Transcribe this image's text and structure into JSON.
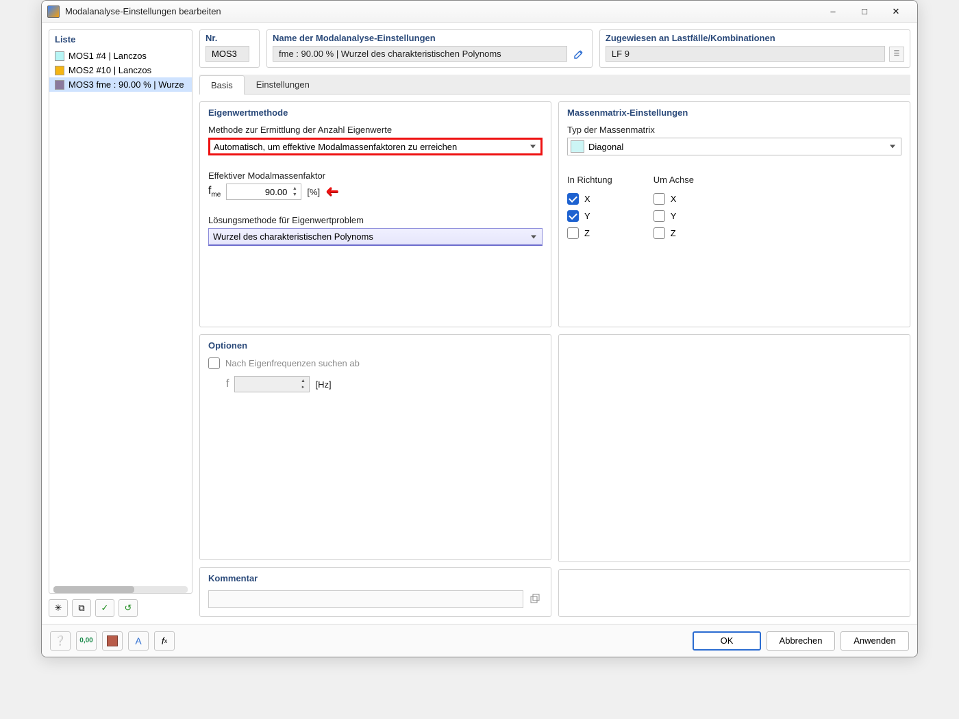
{
  "window": {
    "title": "Modalanalyse-Einstellungen bearbeiten"
  },
  "listPanel": {
    "title": "Liste",
    "items": [
      {
        "swatch": "#b7f5f5",
        "label": "MOS1 #4 | Lanczos"
      },
      {
        "swatch": "#f5b514",
        "label": "MOS2 #10 | Lanczos"
      },
      {
        "swatch": "#8b7a9c",
        "label": "MOS3 fme : 90.00 % | Wurze",
        "selected": true
      }
    ]
  },
  "header": {
    "nrLabel": "Nr.",
    "nrValue": "MOS3",
    "nameLabel": "Name der Modalanalyse-Einstellungen",
    "nameValue": "fme : 90.00 % | Wurzel des charakteristischen Polynoms",
    "assignLabel": "Zugewiesen an Lastfälle/Kombinationen",
    "assignValue": "LF 9"
  },
  "tabs": {
    "t1": "Basis",
    "t2": "Einstellungen"
  },
  "eigen": {
    "groupTitle": "Eigenwertmethode",
    "methodLabel": "Methode zur Ermittlung der Anzahl Eigenwerte",
    "methodValue": "Automatisch, um effektive Modalmassenfaktoren zu erreichen",
    "factorLabel": "Effektiver Modalmassenfaktor",
    "factorSymbol": "fme",
    "factorValue": "90.00",
    "factorUnit": "[%]",
    "solLabel": "Lösungsmethode für Eigenwertproblem",
    "solValue": "Wurzel des charakteristischen Polynoms"
  },
  "mass": {
    "groupTitle": "Massenmatrix-Einstellungen",
    "typeLabel": "Typ der Massenmatrix",
    "typeValue": "Diagonal",
    "dirLabel": "In Richtung",
    "axisLabel": "Um Achse",
    "axes": {
      "x": "X",
      "y": "Y",
      "z": "Z"
    }
  },
  "options": {
    "groupTitle": "Optionen",
    "eigenfreq": "Nach Eigenfrequenzen suchen ab",
    "fSymbol": "f",
    "fUnit": "[Hz]"
  },
  "comment": {
    "groupTitle": "Kommentar"
  },
  "footer": {
    "ok": "OK",
    "cancel": "Abbrechen",
    "apply": "Anwenden"
  }
}
